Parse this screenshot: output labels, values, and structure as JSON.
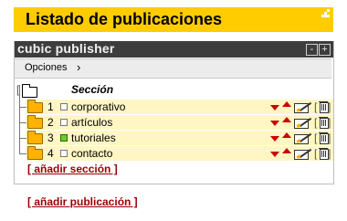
{
  "header": {
    "title": "Listado de publicaciones"
  },
  "panel": {
    "title": "cubic publisher",
    "minimize_label": "-",
    "maximize_label": "+",
    "toolbar": {
      "options_label": "Opciones",
      "chevron": "›"
    },
    "column_header": "Sección",
    "sections": [
      {
        "number": "1",
        "name": "corporativo",
        "status": "inactive"
      },
      {
        "number": "2",
        "name": "artículos",
        "status": "inactive"
      },
      {
        "number": "3",
        "name": "tutoriales",
        "status": "active"
      },
      {
        "number": "4",
        "name": "contacto",
        "status": "inactive"
      }
    ],
    "add_section_label": "[ añadir sección ]"
  },
  "add_publication_label": "[ añadir publicación ]",
  "colors": {
    "title_bar": "#ffcc00",
    "row_bg": "#fff6c4",
    "panel_header": "#3d3d3d",
    "link": "#990000",
    "arrows": "#cc0000",
    "active_status": "#66cc33"
  },
  "icons": {
    "root": "folder-open-icon",
    "section": "folder-icon",
    "move_down": "arrow-down-icon",
    "move_up": "arrow-up-icon",
    "edit": "edit-pencil-icon",
    "delete": "trash-icon"
  }
}
